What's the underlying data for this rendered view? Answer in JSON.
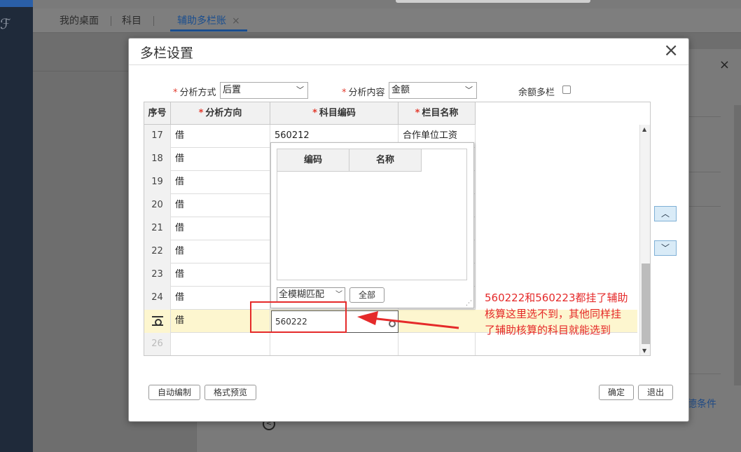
{
  "tabs": [
    {
      "label": "我的桌面"
    },
    {
      "label": "科目"
    },
    {
      "label": "辅助多栏账",
      "close": "×"
    }
  ],
  "rail_glyph": "ℱ",
  "side_panel": {
    "close": "×",
    "filter_link": "德条件",
    "bottom_icon": "<"
  },
  "dialog": {
    "title": "多栏设置",
    "close": "×",
    "fields": {
      "analysis_method_label": "分析方式",
      "analysis_method_value": "后置",
      "analysis_content_label": "分析内容",
      "analysis_content_value": "金额",
      "balance_multi_label": "余额多栏"
    },
    "columns": [
      "序号",
      "分析方向",
      "科目编码",
      "栏目名称"
    ],
    "required_mark": "*",
    "rows": [
      {
        "no": "17",
        "dir": "借",
        "code": "560212",
        "name": "合作单位工资"
      },
      {
        "no": "18",
        "dir": "借"
      },
      {
        "no": "19",
        "dir": "借"
      },
      {
        "no": "20",
        "dir": "借"
      },
      {
        "no": "21",
        "dir": "借"
      },
      {
        "no": "22",
        "dir": "借"
      },
      {
        "no": "23",
        "dir": "借"
      },
      {
        "no": "24",
        "dir": "借"
      },
      {
        "no": "",
        "dir": "借",
        "code": "560222",
        "selected": true
      },
      {
        "no": "26",
        "dir": ""
      }
    ],
    "popup": {
      "columns": [
        "编码",
        "名称"
      ],
      "match_mode": "全模糊匹配",
      "all_button": "全部",
      "resize": "⋰"
    },
    "buttons": {
      "auto": "自动编制",
      "preview": "格式预览",
      "ok": "确定",
      "exit": "退出",
      "move_up": "︿",
      "move_down": "﹀"
    },
    "annotation": "560222和560223都挂了辅助核算这里选不到，其他同样挂了辅助核算的科目就能选到"
  },
  "colors": {
    "accent": "#1a4e8f",
    "annotation": "#e52a2a",
    "selected_row": "#fdf6cf",
    "required": "#e23b2e"
  }
}
